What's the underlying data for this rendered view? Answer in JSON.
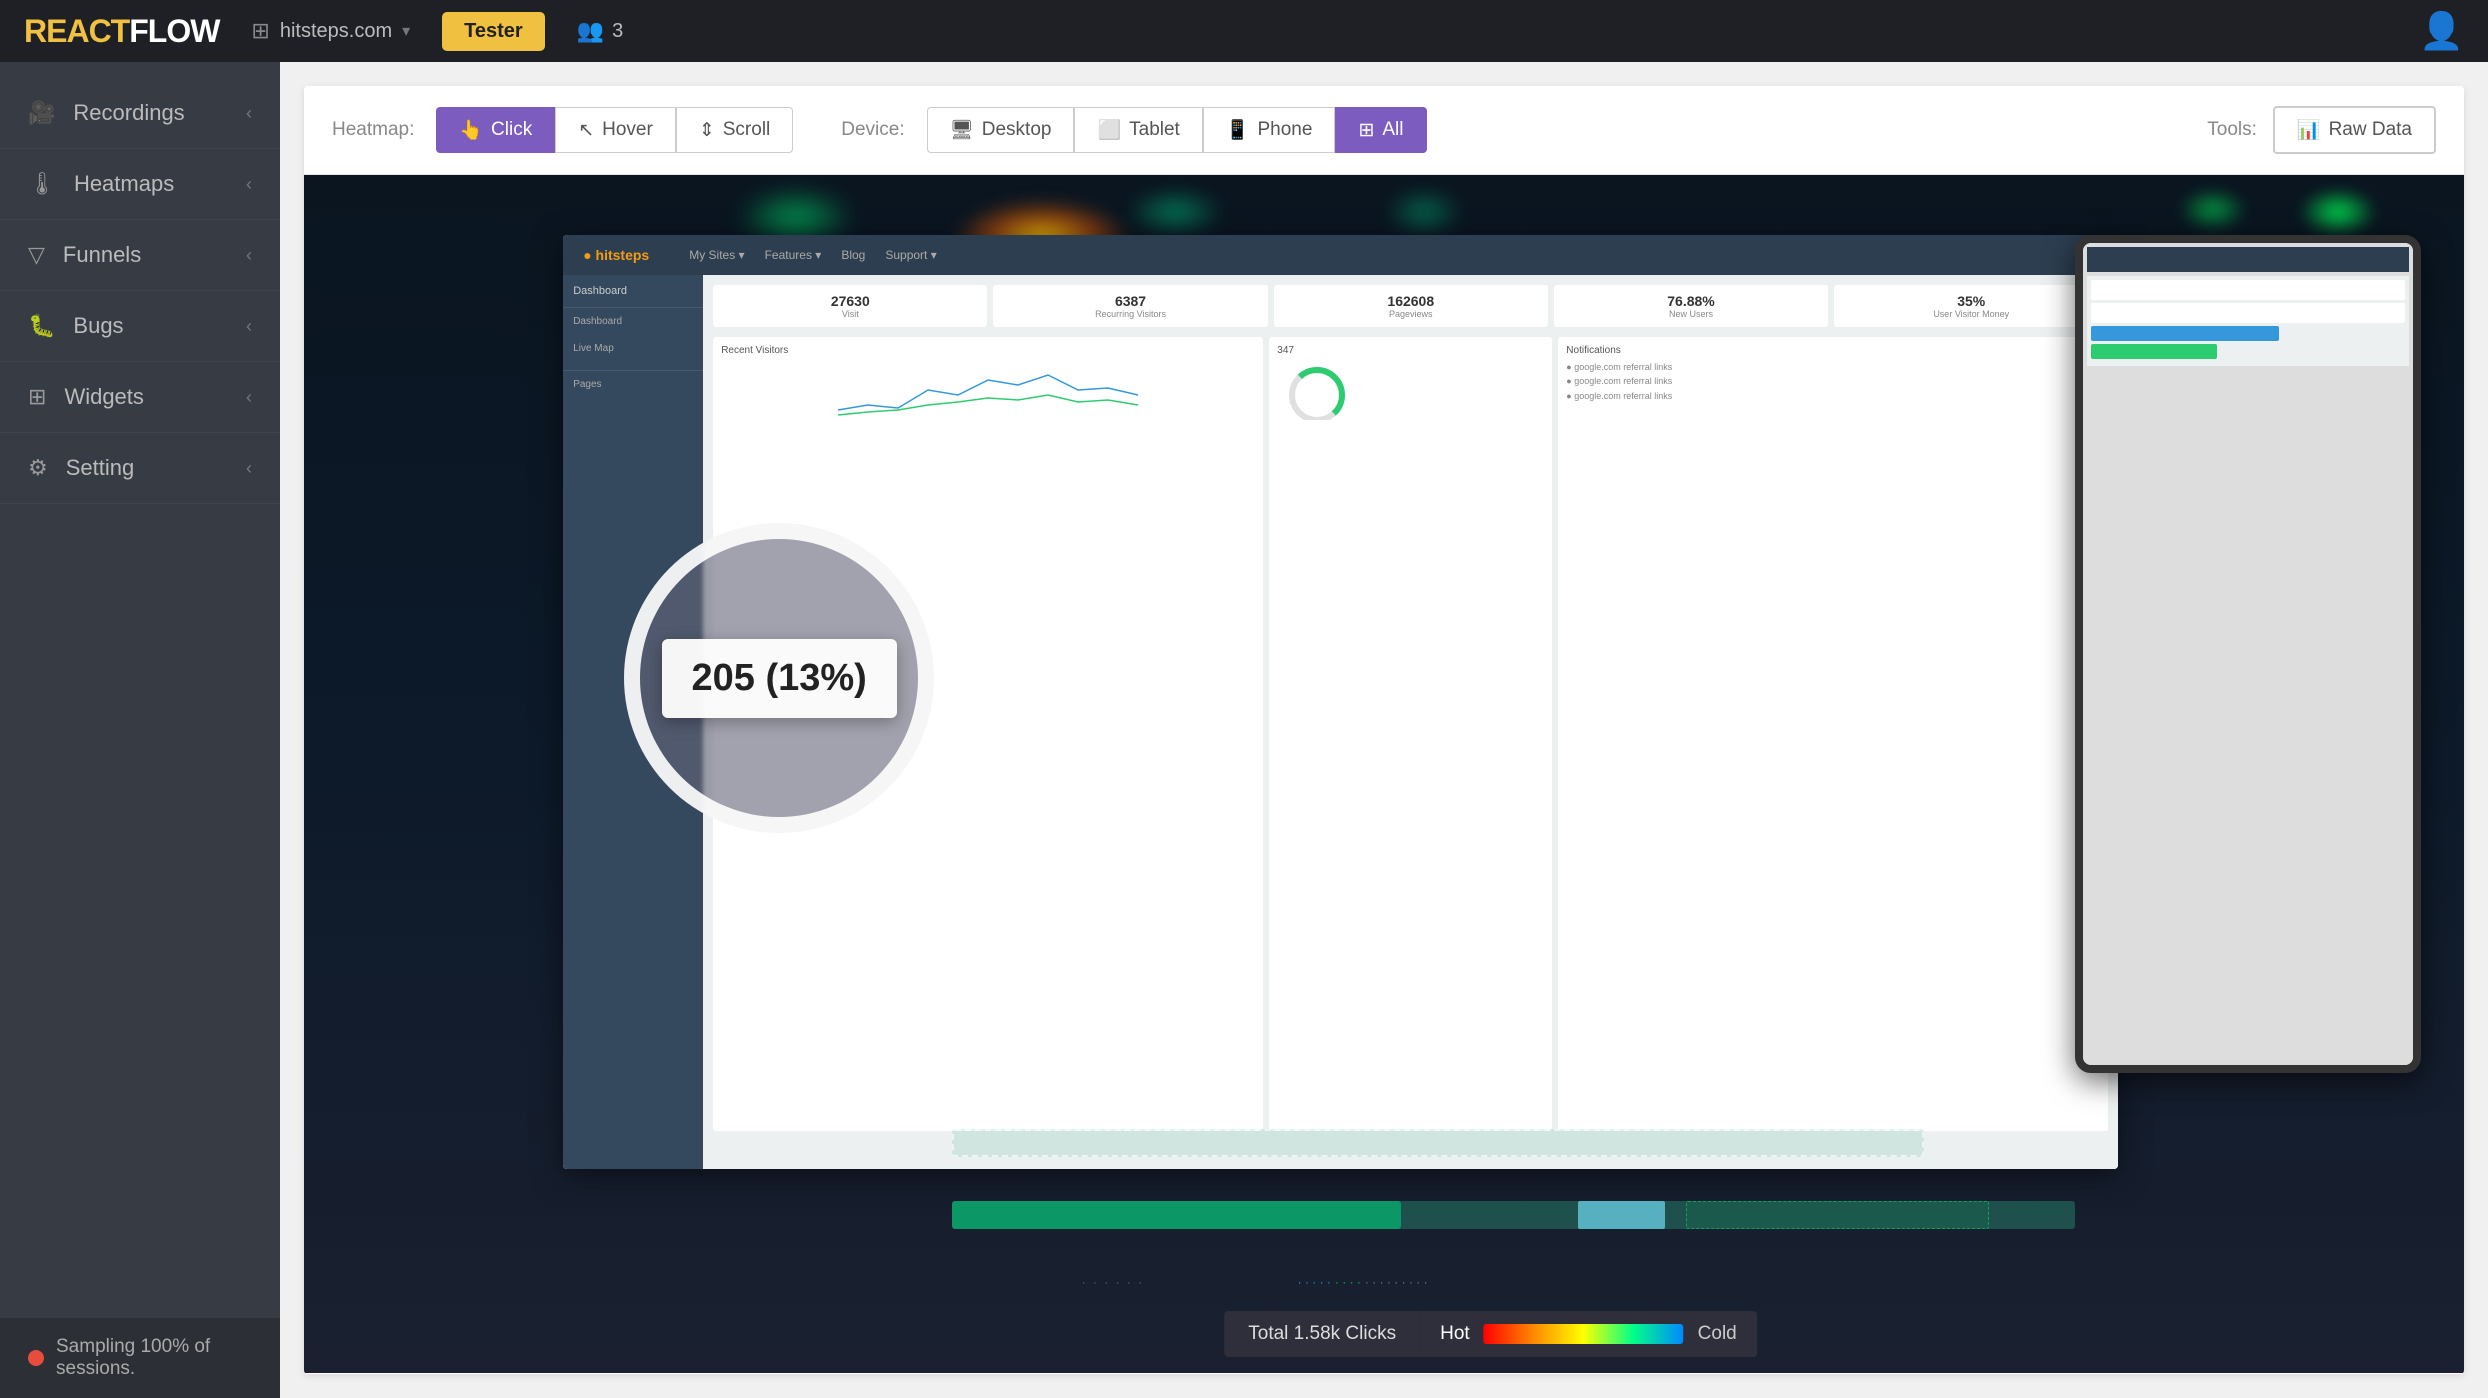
{
  "app": {
    "logo_react": "REACT",
    "logo_flow": "FLOW"
  },
  "topnav": {
    "site": "hitsteps.com",
    "tester_label": "Tester",
    "team_count": "3"
  },
  "sidebar": {
    "items": [
      {
        "id": "recordings",
        "label": "Recordings",
        "icon": "🎥"
      },
      {
        "id": "heatmaps",
        "label": "Heatmaps",
        "icon": "🌡"
      },
      {
        "id": "funnels",
        "label": "Funnels",
        "icon": "▼"
      },
      {
        "id": "bugs",
        "label": "Bugs",
        "icon": "⚙"
      },
      {
        "id": "widgets",
        "label": "Widgets",
        "icon": "⊞"
      },
      {
        "id": "setting",
        "label": "Setting",
        "icon": "⚙"
      }
    ],
    "sampling_text": "Sampling 100% of sessions."
  },
  "heatmap_toolbar": {
    "heatmap_label": "Heatmap:",
    "device_label": "Device:",
    "tools_label": "Tools:",
    "heatmap_buttons": [
      {
        "id": "click",
        "label": "Click",
        "icon": "👆",
        "active": true
      },
      {
        "id": "hover",
        "label": "Hover",
        "icon": "↖",
        "active": false
      },
      {
        "id": "scroll",
        "label": "Scroll",
        "icon": "↕",
        "active": false
      }
    ],
    "device_buttons": [
      {
        "id": "desktop",
        "label": "Desktop",
        "icon": "🖥",
        "active": false
      },
      {
        "id": "tablet",
        "label": "Tablet",
        "icon": "📱",
        "active": false
      },
      {
        "id": "phone",
        "label": "Phone",
        "icon": "📞",
        "active": false
      },
      {
        "id": "all",
        "label": "All",
        "icon": "⊞",
        "active": true
      }
    ],
    "raw_data_label": "Raw Data"
  },
  "heatmap": {
    "zoom_tooltip": "205 (13%)",
    "status": {
      "total_clicks": "Total 1.58k Clicks",
      "hot_label": "Hot",
      "cold_label": "Cold"
    }
  },
  "inner_stats": [
    {
      "num": "27630",
      "label": "Visit"
    },
    {
      "num": "6387",
      "label": "Recurring Visitors"
    },
    {
      "num": "162608",
      "label": "Pageviews"
    },
    {
      "num": "76.88%",
      "label": "New Users"
    },
    {
      "num": "35%",
      "label": "User Visitor Money"
    }
  ]
}
